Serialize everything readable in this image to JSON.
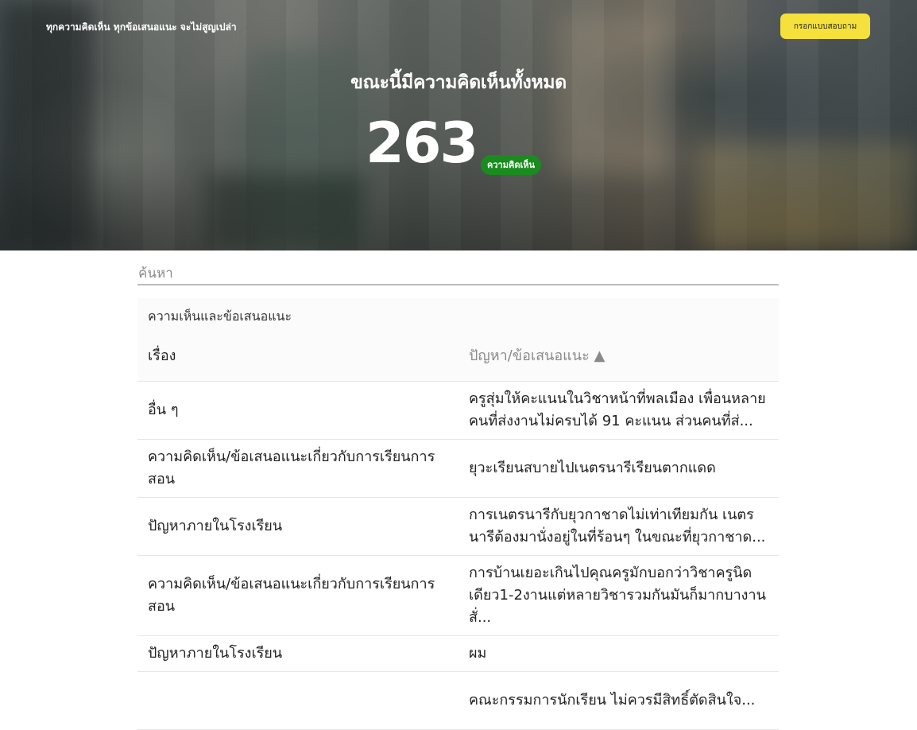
{
  "header": {
    "tagline": "ทุกความคิดเห็น ทุกข้อเสนอแนะ จะไม่สูญเปล่า",
    "survey_button": "กรอกแบบสอบถาม",
    "title": "ขณะนี้มีความคิดเห็นทั้งหมด",
    "count": "263",
    "count_badge": "ความคิดเห็น"
  },
  "search": {
    "placeholder": "ค้นหา"
  },
  "panel": {
    "title": "ความเห็นและข้อเสนอแนะ",
    "columns": {
      "topic": "เรื่อง",
      "detail": "ปัญหา/ข้อเสนอแนะ ▲"
    },
    "rows": [
      {
        "topic": "อื่น ๆ",
        "detail": "ครูสุ่มให้คะแนนในวิชาหน้าที่พลเมือง เพื่อนหลายคนที่ส่งงานไม่ครบได้ 91 คะแนน ส่วนคนที่ส่..."
      },
      {
        "topic": "ความคิดเห็น/ข้อเสนอแนะเกี่ยวกับการเรียนการสอน",
        "detail": "ยุวะเรียนสบายไปเนตรนารีเรียนตากแดด"
      },
      {
        "topic": "ปัญหาภายในโรงเรียน",
        "detail": "การเนตรนารีกับยุวกาชาดไม่เท่าเทียมกัน เนตรนารีต้องมานั่งอยู่ในที่ร้อนๆ ในขณะที่ยุวกาชาด..."
      },
      {
        "topic": "ความคิดเห็น/ข้อเสนอแนะเกี่ยวกับการเรียนการสอน",
        "detail": "การบ้านเยอะเกินไปคุณครูมักบอกว่าวิชาครูนิดเดียว1-2งานแต่หลายวิชารวมกันมันก็มากบางานสั่..."
      },
      {
        "topic": "ปัญหาภายในโรงเรียน",
        "detail": "ผม"
      },
      {
        "topic": "",
        "detail": "คณะกรรมการนักเรียน ไม่ควรมีสิทธิ์ตัดสินใจ..."
      }
    ]
  }
}
